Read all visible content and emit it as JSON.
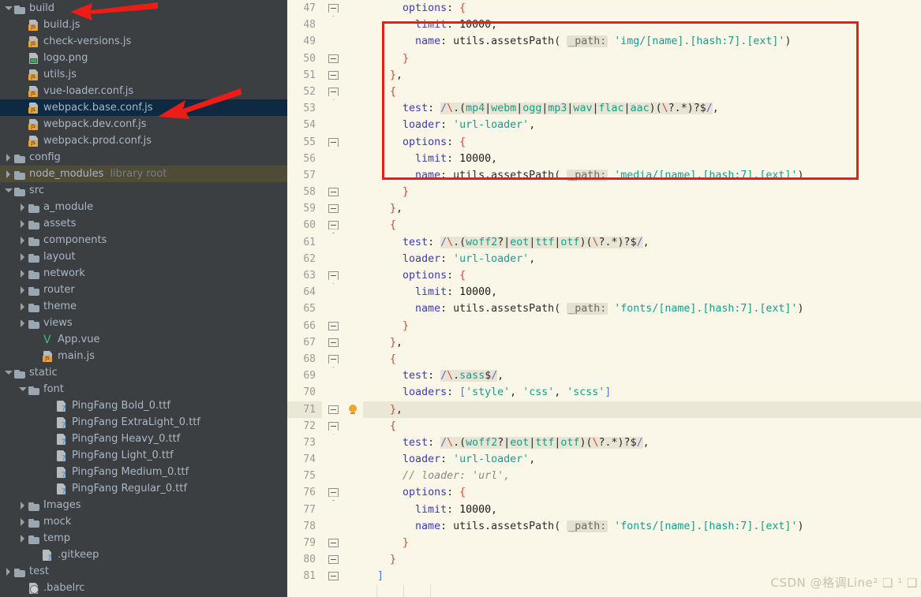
{
  "sidebar": {
    "background_color": "#3c3f41",
    "selected_color": "#0d2a42",
    "library_root_color": "#4e4b36",
    "items": [
      {
        "label": "build",
        "icon": "folder-icon",
        "indent": 0,
        "twisty": "down",
        "state": "normal"
      },
      {
        "label": "build.js",
        "icon": "js-file-icon",
        "indent": 1,
        "twisty": "none",
        "state": "normal"
      },
      {
        "label": "check-versions.js",
        "icon": "js-file-icon",
        "indent": 1,
        "twisty": "none",
        "state": "normal"
      },
      {
        "label": "logo.png",
        "icon": "image-file-icon",
        "indent": 1,
        "twisty": "none",
        "state": "normal"
      },
      {
        "label": "utils.js",
        "icon": "js-file-icon",
        "indent": 1,
        "twisty": "none",
        "state": "normal"
      },
      {
        "label": "vue-loader.conf.js",
        "icon": "js-file-icon",
        "indent": 1,
        "twisty": "none",
        "state": "normal"
      },
      {
        "label": "webpack.base.conf.js",
        "icon": "js-file-icon",
        "indent": 1,
        "twisty": "none",
        "state": "selected"
      },
      {
        "label": "webpack.dev.conf.js",
        "icon": "js-file-icon",
        "indent": 1,
        "twisty": "none",
        "state": "normal"
      },
      {
        "label": "webpack.prod.conf.js",
        "icon": "js-file-icon",
        "indent": 1,
        "twisty": "none",
        "state": "normal"
      },
      {
        "label": "config",
        "icon": "folder-icon",
        "indent": 0,
        "twisty": "right",
        "state": "normal"
      },
      {
        "label": "node_modules",
        "icon": "folder-icon",
        "indent": 0,
        "twisty": "right",
        "state": "library-root",
        "suffix": "library root"
      },
      {
        "label": "src",
        "icon": "folder-icon",
        "indent": 0,
        "twisty": "down",
        "state": "normal"
      },
      {
        "label": "a_module",
        "icon": "folder-icon",
        "indent": 1,
        "twisty": "right",
        "state": "normal"
      },
      {
        "label": "assets",
        "icon": "folder-icon",
        "indent": 1,
        "twisty": "right",
        "state": "normal"
      },
      {
        "label": "components",
        "icon": "folder-icon",
        "indent": 1,
        "twisty": "right",
        "state": "normal"
      },
      {
        "label": "layout",
        "icon": "folder-icon",
        "indent": 1,
        "twisty": "right",
        "state": "normal"
      },
      {
        "label": "network",
        "icon": "folder-icon",
        "indent": 1,
        "twisty": "right",
        "state": "normal"
      },
      {
        "label": "router",
        "icon": "folder-icon",
        "indent": 1,
        "twisty": "right",
        "state": "normal"
      },
      {
        "label": "theme",
        "icon": "folder-icon",
        "indent": 1,
        "twisty": "right",
        "state": "normal"
      },
      {
        "label": "views",
        "icon": "folder-icon",
        "indent": 1,
        "twisty": "right",
        "state": "normal"
      },
      {
        "label": "App.vue",
        "icon": "vue-file-icon",
        "indent": 2,
        "twisty": "none",
        "state": "normal"
      },
      {
        "label": "main.js",
        "icon": "js-file-icon",
        "indent": 2,
        "twisty": "none",
        "state": "normal"
      },
      {
        "label": "static",
        "icon": "folder-icon",
        "indent": 0,
        "twisty": "down",
        "state": "normal"
      },
      {
        "label": "font",
        "icon": "folder-icon",
        "indent": 1,
        "twisty": "down",
        "state": "normal"
      },
      {
        "label": "PingFang Bold_0.ttf",
        "icon": "unknown-file-icon",
        "indent": 3,
        "twisty": "none",
        "state": "normal"
      },
      {
        "label": "PingFang ExtraLight_0.ttf",
        "icon": "unknown-file-icon",
        "indent": 3,
        "twisty": "none",
        "state": "normal"
      },
      {
        "label": "PingFang Heavy_0.ttf",
        "icon": "unknown-file-icon",
        "indent": 3,
        "twisty": "none",
        "state": "normal"
      },
      {
        "label": "PingFang Light_0.ttf",
        "icon": "unknown-file-icon",
        "indent": 3,
        "twisty": "none",
        "state": "normal"
      },
      {
        "label": "PingFang Medium_0.ttf",
        "icon": "unknown-file-icon",
        "indent": 3,
        "twisty": "none",
        "state": "normal"
      },
      {
        "label": "PingFang Regular_0.ttf",
        "icon": "unknown-file-icon",
        "indent": 3,
        "twisty": "none",
        "state": "normal"
      },
      {
        "label": "Images",
        "icon": "folder-icon",
        "indent": 1,
        "twisty": "right",
        "state": "normal"
      },
      {
        "label": "mock",
        "icon": "folder-icon",
        "indent": 1,
        "twisty": "right",
        "state": "normal"
      },
      {
        "label": "temp",
        "icon": "folder-icon",
        "indent": 1,
        "twisty": "right",
        "state": "normal"
      },
      {
        "label": ".gitkeep",
        "icon": "unknown-file-icon",
        "indent": 2,
        "twisty": "none",
        "state": "normal"
      },
      {
        "label": "test",
        "icon": "folder-icon",
        "indent": 0,
        "twisty": "right",
        "state": "normal"
      },
      {
        "label": ".babelrc",
        "icon": "babel-file-icon",
        "indent": 1,
        "twisty": "none",
        "state": "normal"
      }
    ]
  },
  "editor": {
    "background_color": "#faf6e8",
    "highlighted_line": 71,
    "first_visible_line": 47,
    "last_visible_line": 81,
    "annotation_box_color": "#ec1c16",
    "lines": [
      {
        "n": 47,
        "fold": "start",
        "text": "      options: {"
      },
      {
        "n": 48,
        "fold": "none",
        "text": "        limit: 10000,"
      },
      {
        "n": 49,
        "fold": "none",
        "text": "        name: utils.assetsPath( _path: 'img/[name].[hash:7].[ext]')"
      },
      {
        "n": 50,
        "fold": "middle",
        "text": "      }"
      },
      {
        "n": 51,
        "fold": "middle",
        "text": "    },"
      },
      {
        "n": 52,
        "fold": "start",
        "text": "    {"
      },
      {
        "n": 53,
        "fold": "none",
        "text": "      test: /\\.(mp4|webm|ogg|mp3|wav|flac|aac)(\\?.*)?$/,"
      },
      {
        "n": 54,
        "fold": "none",
        "text": "      loader: 'url-loader',"
      },
      {
        "n": 55,
        "fold": "start",
        "text": "      options: {"
      },
      {
        "n": 56,
        "fold": "none",
        "text": "        limit: 10000,"
      },
      {
        "n": 57,
        "fold": "none",
        "text": "        name: utils.assetsPath( _path: 'media/[name].[hash:7].[ext]')"
      },
      {
        "n": 58,
        "fold": "middle",
        "text": "      }"
      },
      {
        "n": 59,
        "fold": "middle",
        "text": "    },"
      },
      {
        "n": 60,
        "fold": "start",
        "text": "    {"
      },
      {
        "n": 61,
        "fold": "none",
        "text": "      test: /\\.(woff2?|eot|ttf|otf)(\\?.*)?$/,"
      },
      {
        "n": 62,
        "fold": "none",
        "text": "      loader: 'url-loader',"
      },
      {
        "n": 63,
        "fold": "start",
        "text": "      options: {"
      },
      {
        "n": 64,
        "fold": "none",
        "text": "        limit: 10000,"
      },
      {
        "n": 65,
        "fold": "none",
        "text": "        name: utils.assetsPath( _path: 'fonts/[name].[hash:7].[ext]')"
      },
      {
        "n": 66,
        "fold": "middle",
        "text": "      }"
      },
      {
        "n": 67,
        "fold": "middle",
        "text": "    },"
      },
      {
        "n": 68,
        "fold": "start",
        "text": "    {"
      },
      {
        "n": 69,
        "fold": "none",
        "text": "      test: /\\.sass$/,"
      },
      {
        "n": 70,
        "fold": "none",
        "text": "      loaders: ['style', 'css', 'scss']"
      },
      {
        "n": 71,
        "fold": "middle",
        "text": "    },",
        "bulb": true
      },
      {
        "n": 72,
        "fold": "start",
        "text": "    {"
      },
      {
        "n": 73,
        "fold": "none",
        "text": "      test: /\\.(woff2?|eot|ttf|otf)(\\?.*)?$/,"
      },
      {
        "n": 74,
        "fold": "none",
        "text": "      loader: 'url-loader',"
      },
      {
        "n": 75,
        "fold": "none",
        "text": "      // loader: 'url',"
      },
      {
        "n": 76,
        "fold": "start",
        "text": "      options: {"
      },
      {
        "n": 77,
        "fold": "none",
        "text": "        limit: 10000,"
      },
      {
        "n": 78,
        "fold": "none",
        "text": "        name: utils.assetsPath( _path: 'fonts/[name].[hash:7].[ext]')"
      },
      {
        "n": 79,
        "fold": "middle",
        "text": "      }"
      },
      {
        "n": 80,
        "fold": "middle",
        "text": "    }"
      },
      {
        "n": 81,
        "fold": "middle",
        "text": "  ]"
      }
    ]
  },
  "watermark": {
    "text": "CSDN @格调Line² ❑ ¹ ❑"
  },
  "annotations": {
    "arrow_color": "#ec1c16",
    "arrow_build_target": "build",
    "arrow_file_target": "webpack.base.conf.js"
  }
}
